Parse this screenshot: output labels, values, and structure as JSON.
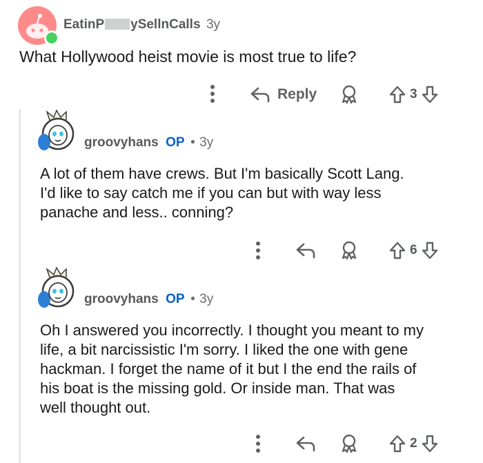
{
  "colors": {
    "accent_op": "#0a5fc7",
    "online": "#46d160",
    "avatar_bg": "#ff8a8a",
    "text": "#1a1a1b",
    "muted": "#5f6265"
  },
  "post": {
    "author_pre": "EatinP",
    "author_post": "ySellnCalls",
    "age": "3y",
    "body": "What Hollywood heist movie is most true to life?",
    "reply_label": "Reply",
    "votes": "3",
    "icons": [
      "more-icon",
      "reply-icon",
      "award-icon",
      "upvote-icon",
      "downvote-icon"
    ]
  },
  "comments": [
    {
      "author": "groovyhans",
      "badge": "OP",
      "separator": "•",
      "age": "3y",
      "lines": [
        "A lot of them have crews. But I'm basically Scott Lang.",
        "I'd like to say catch me if you can but with way less",
        "panache and less.. conning?"
      ],
      "votes": "6"
    },
    {
      "author": "groovyhans",
      "badge": "OP",
      "separator": "•",
      "age": "3y",
      "lines": [
        "Oh I answered you incorrectly. I thought you meant to my",
        "life, a bit narcissistic I'm sorry. I liked the one with gene",
        "hackman. I forget the name of it but I the end the rails of",
        "his boat is the missing gold. Or inside man. That was",
        "well thought out."
      ],
      "votes": "2"
    }
  ]
}
